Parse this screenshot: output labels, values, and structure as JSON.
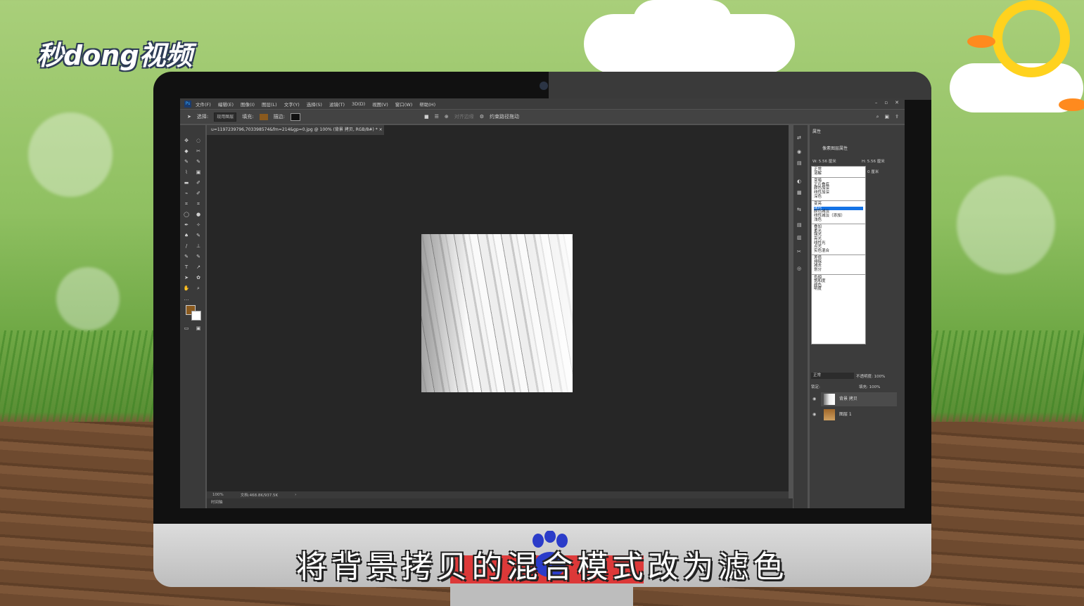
{
  "brand": {
    "logo_text": "秒dong视频"
  },
  "subtitle": "将背景拷贝的混合模式改为滤色",
  "app": {
    "menus": [
      "文件(F)",
      "编辑(E)",
      "图像(I)",
      "图层(L)",
      "文字(Y)",
      "选择(S)",
      "滤镜(T)",
      "3D(D)",
      "视图(V)",
      "窗口(W)",
      "帮助(H)"
    ],
    "options": {
      "select_label": "选择:",
      "select_value": "现用图层",
      "fill_label": "填充:",
      "stroke_label": "描边:",
      "align_edges": "对齐边缘",
      "constrain": "约束路径拖动"
    },
    "doc_tab": "u=1197239796,703398574&fm=214&gp=0.jpg @ 100% (背景 拷贝, RGB/8#) * ×",
    "status": {
      "zoom": "100%",
      "doc": "文档:468.8K/937.5K"
    },
    "timeline_label": "时间轴",
    "panel": {
      "tab": "属性",
      "subtitle": "像素图层属性",
      "w_label": "W: 5.56 厘米",
      "h_label": "H: 5.56 厘米",
      "x_label": "0 厘米"
    },
    "blend_modes": [
      [
        "正常",
        "溶解"
      ],
      [
        "变暗",
        "正片叠底",
        "颜色加深",
        "线性加深",
        "深色"
      ],
      [
        "变亮",
        "滤色",
        "颜色减淡",
        "线性减淡（添加）",
        "浅色"
      ],
      [
        "叠加",
        "柔光",
        "强光",
        "亮光",
        "线性光",
        "点光",
        "实色混合"
      ],
      [
        "差值",
        "排除",
        "减去",
        "划分"
      ],
      [
        "色相",
        "饱和度",
        "颜色",
        "明度"
      ]
    ],
    "selected_mode": "滤色",
    "layers_bar": {
      "mode": "正常",
      "opacity_label": "不透明度: 100%",
      "lock_label": "锁定:",
      "fill_label": "填充: 100%"
    },
    "layers": [
      {
        "name": "背景 拷贝",
        "active": true
      },
      {
        "name": "图层 1",
        "active": false
      }
    ]
  }
}
